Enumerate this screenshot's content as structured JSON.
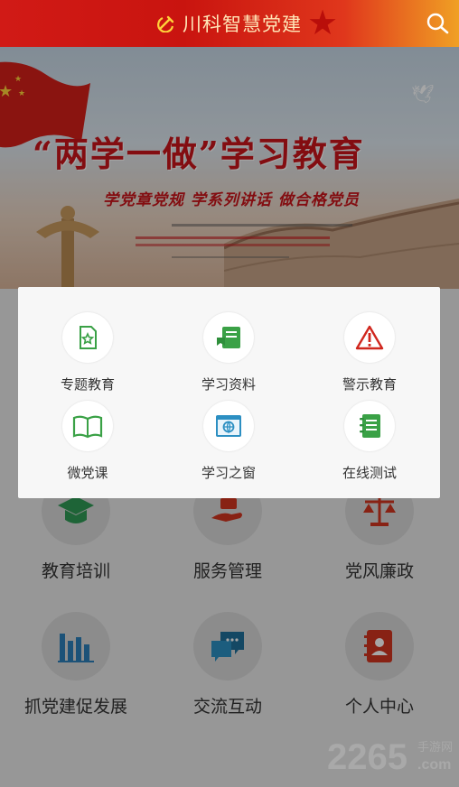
{
  "header": {
    "title": "川科智慧党建",
    "emblem_icon": "party-emblem-icon",
    "search_icon": "search-icon",
    "bg_color": "#d11a16",
    "title_color": "#ffe6b8"
  },
  "banner": {
    "headline": "“两学一做”学习教育",
    "subline": "学党章党规  学系列讲话  做合格党员"
  },
  "popup": {
    "items": [
      {
        "label": "专题教育",
        "icon": "document-star-icon"
      },
      {
        "label": "学习资料",
        "icon": "study-book-icon"
      },
      {
        "label": "警示教育",
        "icon": "warning-icon"
      },
      {
        "label": "微党课",
        "icon": "open-book-icon"
      },
      {
        "label": "学习之窗",
        "icon": "browser-window-icon"
      },
      {
        "label": "在线测试",
        "icon": "notebook-icon"
      }
    ]
  },
  "grid": {
    "items": [
      {
        "label": "教育培训",
        "icon": "graduation-cap-icon"
      },
      {
        "label": "服务管理",
        "icon": "hand-service-icon"
      },
      {
        "label": "党风廉政",
        "icon": "scales-icon"
      },
      {
        "label": "抓党建促发展",
        "icon": "bar-chart-icon"
      },
      {
        "label": "交流互动",
        "icon": "chat-bubbles-icon"
      },
      {
        "label": "个人中心",
        "icon": "contact-book-icon"
      }
    ]
  },
  "watermark": {
    "number": "2265",
    "site": "手游网",
    "domain": ".com"
  }
}
